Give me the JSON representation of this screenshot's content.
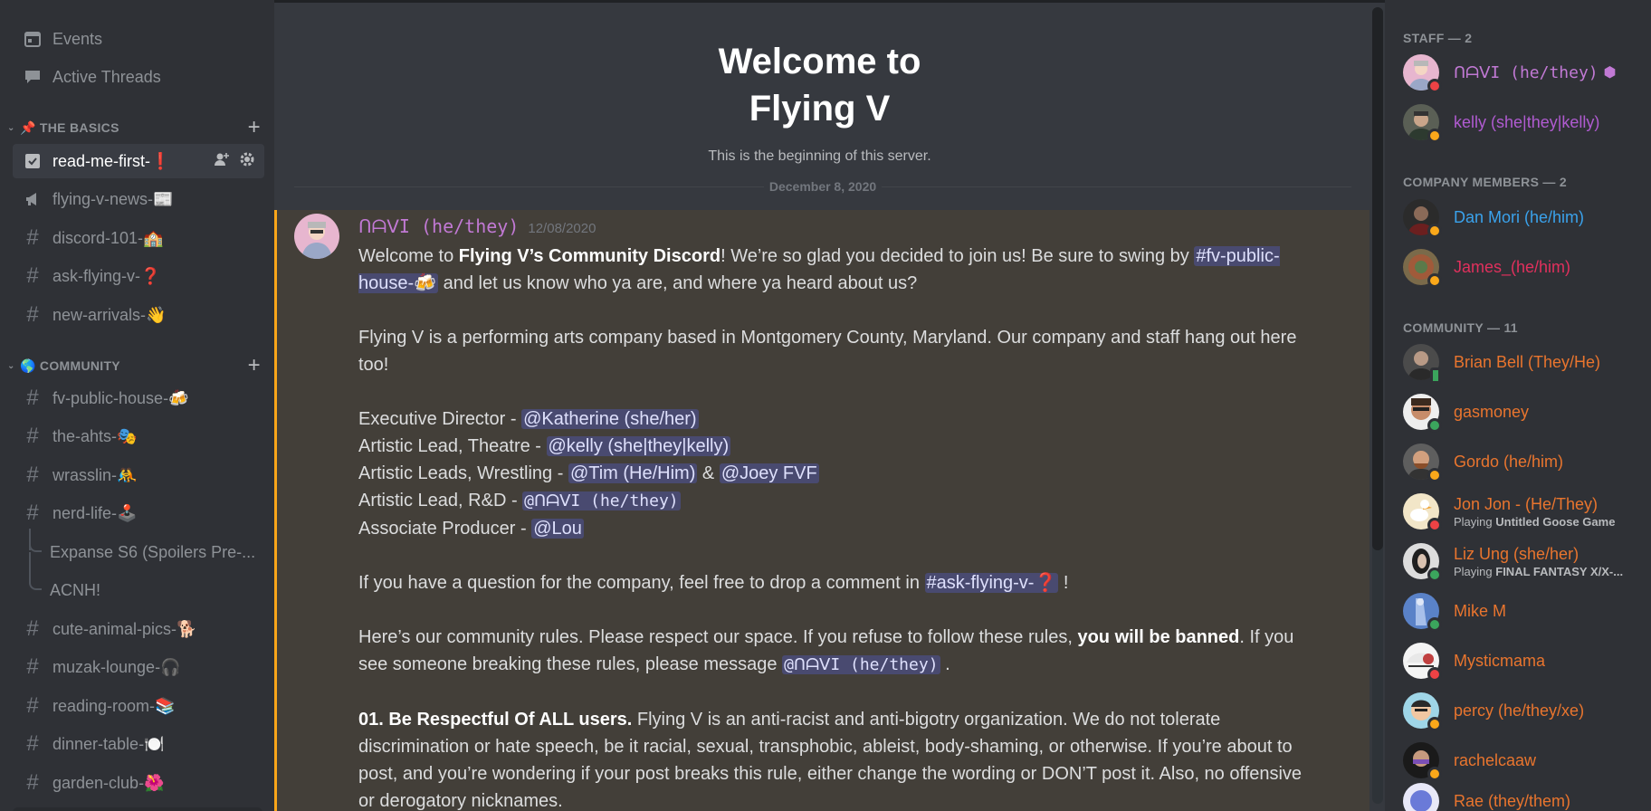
{
  "sidebar": {
    "top_items": [
      {
        "label": "Events",
        "icon": "calendar-icon"
      },
      {
        "label": "Active Threads",
        "icon": "threads-icon"
      }
    ],
    "categories": [
      {
        "name": "📌 THE BASICS",
        "channels": [
          {
            "label": "read-me-first-❗",
            "icon": "rules-icon",
            "active": true
          },
          {
            "label": "flying-v-news-📰",
            "icon": "announcement-icon"
          },
          {
            "label": "discord-101-🏫",
            "icon": "hash-icon"
          },
          {
            "label": "ask-flying-v-❓",
            "icon": "hash-icon"
          },
          {
            "label": "new-arrivals-👋",
            "icon": "hash-icon"
          }
        ]
      },
      {
        "name": "🌎 COMMUNITY",
        "channels": [
          {
            "label": "fv-public-house-🍻",
            "icon": "hash-icon"
          },
          {
            "label": "the-ahts-🎭",
            "icon": "hash-icon"
          },
          {
            "label": "wrasslin-🤼",
            "icon": "hash-icon"
          },
          {
            "label": "nerd-life-🕹️",
            "icon": "hash-thread-icon"
          },
          {
            "label": "Expanse S6 (Spoilers Pre-...",
            "icon": "thread"
          },
          {
            "label": "ACNH!",
            "icon": "thread"
          },
          {
            "label": "cute-animal-pics-🐕",
            "icon": "hash-icon"
          },
          {
            "label": "muzak-lounge-🎧",
            "icon": "hash-icon"
          },
          {
            "label": "reading-room-📚",
            "icon": "hash-icon"
          },
          {
            "label": "dinner-table-🍽️",
            "icon": "hash-icon"
          },
          {
            "label": "garden-club-🌺",
            "icon": "hash-icon"
          }
        ]
      }
    ]
  },
  "main": {
    "welcome_title": "Welcome to Flying V",
    "welcome_sub": "This is the beginning of this server.",
    "date_divider": "December 8, 2020",
    "message": {
      "author": "ᑎᗩᐯI (he/they)",
      "timestamp": "12/08/2020",
      "p1_a": "Welcome to ",
      "p1_b": "Flying V’s Community Discord",
      "p1_c": "! We’re so glad you decided to join us! Be sure to swing by ",
      "p1_mention": "#fv-public-house-🍻",
      "p1_d": " and let us know who ya are, and where ya heard about us?",
      "p2": "Flying V is a performing arts company based in Montgomery County, Maryland. Our company and staff hang out here too!",
      "staff_lines": [
        {
          "role": "Executive Director - ",
          "mentions": [
            "@Katherine (she/her)"
          ]
        },
        {
          "role": "Artistic Lead, Theatre - ",
          "mentions": [
            "@kelly (she|they|kelly)"
          ]
        },
        {
          "role": "Artistic Leads, Wrestling - ",
          "mentions": [
            "@Tim (He/Him)",
            "@Joey FVF"
          ],
          "joiner": " & "
        },
        {
          "role": "Artistic Lead, R&D - ",
          "mentions": [
            "@ᑎᗩᐯI (he/they)"
          ]
        },
        {
          "role": "Associate Producer - ",
          "mentions": [
            "@Lou"
          ]
        }
      ],
      "p4_a": "If you have a question for the company, feel free to drop a comment in ",
      "p4_mention": "#ask-flying-v-❓",
      "p4_b": " !",
      "p5_a": "Here’s our community rules. Please respect our space. If you refuse to follow these rules, ",
      "p5_b": "you will be banned",
      "p5_c": ".  If you see someone breaking these rules, please message ",
      "p5_mention": "@ᑎᗩᐯI (he/they)",
      "p5_d": " .",
      "rule1_title": "01. Be Respectful Of ALL users.",
      "rule1_text": " Flying V is an anti-racist and anti-bigotry organization. We do not tolerate discrimination or hate speech, be it racial, sexual, transphobic, ableist, body-shaming, or otherwise. If you’re about to post, and you’re wondering if your post breaks this rule, either change the wording or DON’T post it. Also, no offensive or derogatory nicknames."
    }
  },
  "members": {
    "groups": [
      {
        "heading": "STAFF — 2",
        "members": [
          {
            "name": "ᑎᗩᐯI (he/they)",
            "color": "#c179d4",
            "status": "dnd",
            "badge": true
          },
          {
            "name": "kelly (she|they|kelly)",
            "color": "#b05bd1",
            "status": "idle"
          }
        ]
      },
      {
        "heading": "COMPANY MEMBERS — 2",
        "members": [
          {
            "name": "Dan Mori (he/him)",
            "color": "#3aa2ec",
            "status": "idle"
          },
          {
            "name": "James_(he/him)",
            "color": "#e1305d",
            "status": "idle"
          }
        ]
      },
      {
        "heading": "COMMUNITY — 11",
        "members": [
          {
            "name": "Brian Bell (They/He)",
            "color": "#e9752e",
            "status": "mobile"
          },
          {
            "name": "gasmoney",
            "color": "#e9752e",
            "status": "online"
          },
          {
            "name": "Gordo (he/him)",
            "color": "#e9752e",
            "status": "idle"
          },
          {
            "name": "Jon Jon - (He/They)",
            "color": "#e9752e",
            "status": "dnd",
            "activity_prefix": "Playing ",
            "activity": "Untitled Goose Game"
          },
          {
            "name": "Liz Ung (she/her)",
            "color": "#e9752e",
            "status": "online",
            "activity_prefix": "Playing ",
            "activity": "FINAL FANTASY X/X-..."
          },
          {
            "name": "Mike M",
            "color": "#e9752e",
            "status": "online"
          },
          {
            "name": "Mysticmama",
            "color": "#e9752e",
            "status": "dnd"
          },
          {
            "name": "percy (he/they/xe)",
            "color": "#e9752e",
            "status": "idle"
          },
          {
            "name": "rachelcaaw",
            "color": "#e9752e",
            "status": "idle"
          },
          {
            "name": "Rae (they/them)",
            "color": "#e9752e",
            "status": "idle"
          }
        ]
      }
    ]
  }
}
